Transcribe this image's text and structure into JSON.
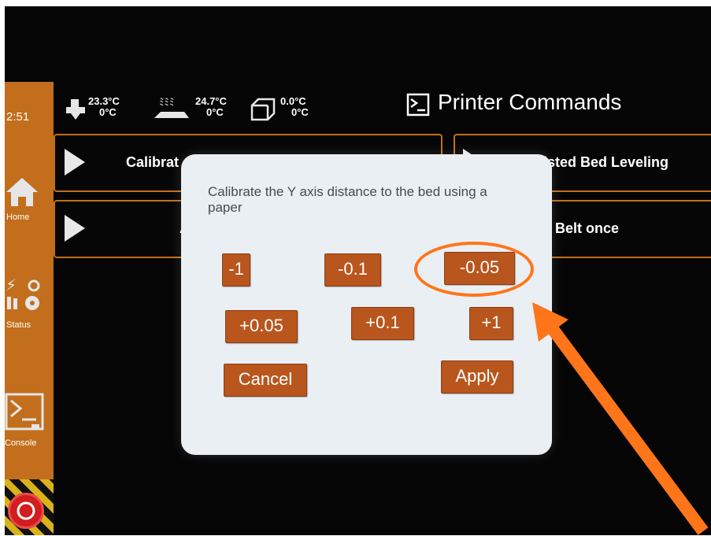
{
  "statusbar": {
    "time": "2:51",
    "hotend": {
      "current": "23.3°C",
      "target": "0°C"
    },
    "bed": {
      "current": "24.7°C",
      "target": "0°C"
    },
    "chamber": {
      "current": "0.0°C",
      "target": "0°C"
    }
  },
  "header": {
    "title": "Printer Commands",
    "icon": "console-icon"
  },
  "sidebar": {
    "items": [
      {
        "label": "Home",
        "icon": "home-icon"
      },
      {
        "label": "Status",
        "icon": "status-icon"
      },
      {
        "label": "Console",
        "icon": "console-icon"
      }
    ],
    "estop_icon": "emergency-stop-icon"
  },
  "commands": [
    {
      "label": "Calibrat",
      "icon": "play-icon"
    },
    {
      "label": "isted Bed Leveling",
      "icon": "play-icon"
    },
    {
      "label": "A",
      "icon": "play-icon"
    },
    {
      "label": "ll Belt once",
      "icon": "play-icon"
    }
  ],
  "dialog": {
    "message": "Calibrate the Y axis distance to the bed using a paper",
    "buttons": {
      "minus_1": "-1",
      "minus_0_1": "-0.1",
      "minus_0_05": "-0.05",
      "plus_0_05": "+0.05",
      "plus_0_1": "+0.1",
      "plus_1": "+1",
      "cancel": "Cancel",
      "apply": "Apply"
    }
  },
  "colors": {
    "accent": "#c26e1c",
    "button": "#b9561d",
    "dialog_bg": "#eaeff4",
    "annotation": "#ff7519"
  }
}
